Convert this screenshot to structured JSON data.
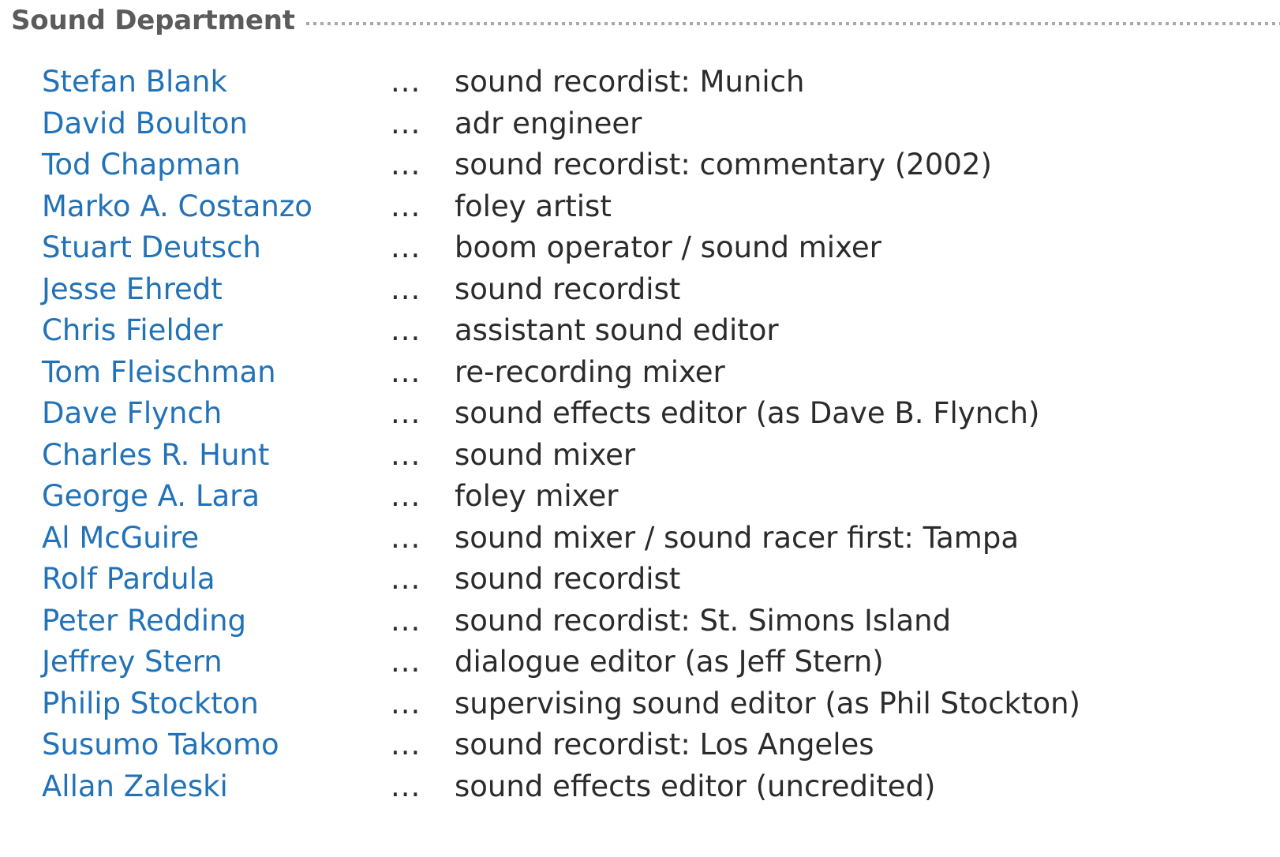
{
  "section": {
    "title": "Sound Department",
    "separator": "...",
    "title_color": "#5b5b5b",
    "link_color": "#2272b8",
    "role_color": "#2b2b2b",
    "rule_color": "#a9a9a9",
    "background_color": "#ffffff"
  },
  "credits": [
    {
      "name": "Stefan Blank",
      "separator": "...",
      "role": "sound recordist: Munich"
    },
    {
      "name": "David Boulton",
      "separator": "...",
      "role": "adr engineer"
    },
    {
      "name": "Tod Chapman",
      "separator": "...",
      "role": "sound recordist: commentary (2002)"
    },
    {
      "name": "Marko A. Costanzo",
      "separator": "...",
      "role": "foley artist"
    },
    {
      "name": "Stuart Deutsch",
      "separator": "...",
      "role": "boom operator / sound mixer"
    },
    {
      "name": "Jesse Ehredt",
      "separator": "...",
      "role": "sound recordist"
    },
    {
      "name": "Chris Fielder",
      "separator": "...",
      "role": "assistant sound editor"
    },
    {
      "name": "Tom Fleischman",
      "separator": "...",
      "role": "re-recording mixer"
    },
    {
      "name": "Dave Flynch",
      "separator": "...",
      "role": "sound effects editor (as Dave B. Flynch)"
    },
    {
      "name": "Charles R. Hunt",
      "separator": "...",
      "role": "sound mixer"
    },
    {
      "name": "George A. Lara",
      "separator": "...",
      "role": "foley mixer"
    },
    {
      "name": "Al McGuire",
      "separator": "...",
      "role": "sound mixer / sound racer first: Tampa"
    },
    {
      "name": "Rolf Pardula",
      "separator": "...",
      "role": "sound recordist"
    },
    {
      "name": "Peter Redding",
      "separator": "...",
      "role": "sound recordist: St. Simons Island"
    },
    {
      "name": "Jeffrey Stern",
      "separator": "...",
      "role": "dialogue editor (as Jeff Stern)"
    },
    {
      "name": "Philip Stockton",
      "separator": "...",
      "role": "supervising sound editor (as Phil Stockton)"
    },
    {
      "name": "Susumo Takomo",
      "separator": "...",
      "role": "sound recordist: Los Angeles"
    },
    {
      "name": "Allan Zaleski",
      "separator": "...",
      "role": "sound effects editor (uncredited)"
    }
  ]
}
